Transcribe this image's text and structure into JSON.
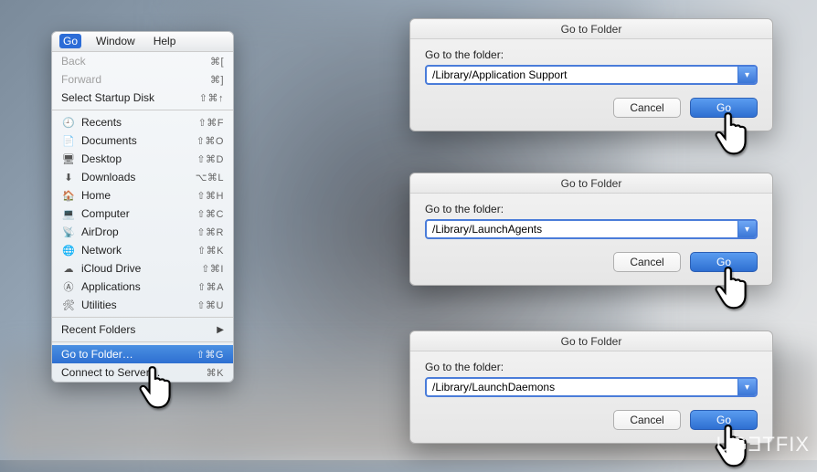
{
  "menu_header": {
    "go": "Go",
    "window": "Window",
    "help": "Help"
  },
  "menu": {
    "back": {
      "label": "Back",
      "shortcut": "⌘["
    },
    "forward": {
      "label": "Forward",
      "shortcut": "⌘]"
    },
    "startup": {
      "label": "Select Startup Disk",
      "shortcut": "⇧⌘↑"
    },
    "recents": {
      "label": "Recents",
      "shortcut": "⇧⌘F"
    },
    "documents": {
      "label": "Documents",
      "shortcut": "⇧⌘O"
    },
    "desktop": {
      "label": "Desktop",
      "shortcut": "⇧⌘D"
    },
    "downloads": {
      "label": "Downloads",
      "shortcut": "⌥⌘L"
    },
    "home": {
      "label": "Home",
      "shortcut": "⇧⌘H"
    },
    "computer": {
      "label": "Computer",
      "shortcut": "⇧⌘C"
    },
    "airdrop": {
      "label": "AirDrop",
      "shortcut": "⇧⌘R"
    },
    "network": {
      "label": "Network",
      "shortcut": "⇧⌘K"
    },
    "icloud": {
      "label": "iCloud Drive",
      "shortcut": "⇧⌘I"
    },
    "applications": {
      "label": "Applications",
      "shortcut": "⇧⌘A"
    },
    "utilities": {
      "label": "Utilities",
      "shortcut": "⇧⌘U"
    },
    "recentfolders": {
      "label": "Recent Folders"
    },
    "gotofolder": {
      "label": "Go to Folder…",
      "shortcut": "⇧⌘G"
    },
    "connect": {
      "label": "Connect to Server…",
      "shortcut": "⌘K"
    }
  },
  "icons": {
    "recents": "🕘",
    "documents": "📄",
    "desktop": "🖥",
    "downloads": "⬇",
    "home": "🏠",
    "computer": "💻",
    "airdrop": "📡",
    "network": "🌐",
    "icloud": "☁",
    "applications": "Ⓐ",
    "utilities": "🛠"
  },
  "dialog": {
    "title": "Go to Folder",
    "label": "Go to the folder:",
    "cancel": "Cancel",
    "go": "Go",
    "paths": {
      "d1": "/Library/Application Support",
      "d2": "/Library/LaunchAgents",
      "d3": "/Library/LaunchDaemons"
    }
  },
  "watermark": "UGƎTFIX"
}
